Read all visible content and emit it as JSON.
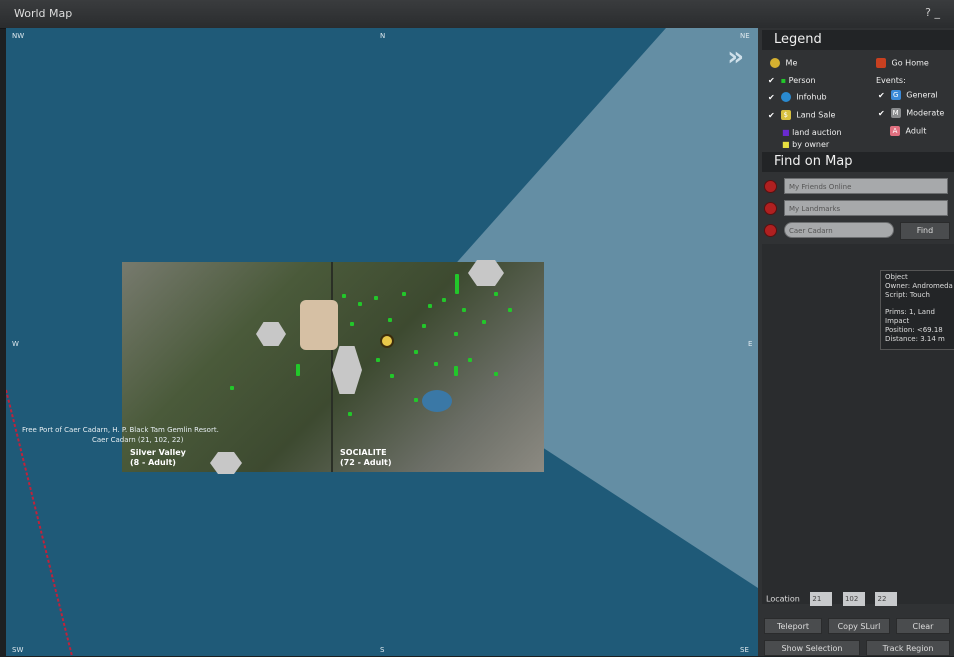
{
  "window": {
    "title": "World Map",
    "help": "?  _"
  },
  "compass": {
    "nw": "NW",
    "n": "N",
    "ne": "NE",
    "w": "W",
    "e": "E",
    "sw": "SW",
    "s": "S",
    "se": "SE"
  },
  "map": {
    "region_left": {
      "name": "Silver Valley",
      "rating": "(8 - Adult)"
    },
    "region_right": {
      "name": "SOCIALITE",
      "rating": "(72 - Adult)"
    },
    "label_line1": "Free Port of Caer Cadarn, H. P. Black Tam Gemlin Resort.",
    "label_line2": "Caer Cadarn (21, 102, 22)"
  },
  "legend": {
    "heading": "Legend",
    "me": "Me",
    "go_home": "Go Home",
    "person": "Person",
    "infohub": "Infohub",
    "land_sale": "Land Sale",
    "events": "Events:",
    "general": "General",
    "moderate": "Moderate",
    "adult": "Adult",
    "auction": "land auction",
    "by_owner": "by owner"
  },
  "find": {
    "heading": "Find on Map",
    "friends": "My Friends Online",
    "landmarks": "My Landmarks",
    "search_value": "Caer Cadarn",
    "find_button": "Find"
  },
  "tooltip": {
    "l1": "Object",
    "l2": "Owner: Andromeda",
    "l3": "Script: Touch",
    "l4": "Prims: 1, Land Impact",
    "l5": "Position: <69.18",
    "l6": "Distance: 3.14 m"
  },
  "location": {
    "label": "Location",
    "x": "21",
    "y": "102",
    "z": "22"
  },
  "buttons": {
    "teleport": "Teleport",
    "copy_slurl": "Copy SLurl",
    "clear": "Clear",
    "show_selection": "Show Selection",
    "track_region": "Track Region"
  }
}
